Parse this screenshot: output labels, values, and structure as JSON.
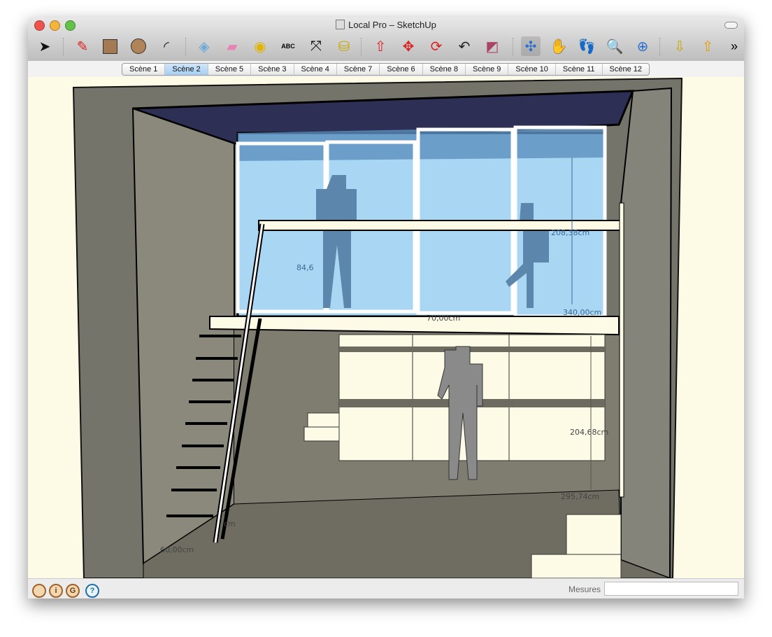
{
  "window": {
    "title": "SketchUp",
    "document_title": "Local Pro"
  },
  "title_separator": " – ",
  "toolbar": {
    "tools": [
      "select-icon",
      "pencil-icon",
      "rectangle-icon",
      "circle-icon",
      "arc-icon",
      "make-component-icon",
      "eraser-icon",
      "tape-measure-icon",
      "text-icon",
      "axes-icon",
      "paint-bucket-icon",
      "push-pull-icon",
      "move-icon",
      "rotate-icon",
      "follow-me-icon",
      "offset-icon",
      "orbit-icon",
      "pan-icon",
      "walk-icon",
      "zoom-icon",
      "zoom-extents-icon",
      "get-models-icon",
      "share-model-icon"
    ],
    "overflow_label": "»"
  },
  "scenes": {
    "tabs": [
      "Scène 1",
      "Scène 2",
      "Scène 5",
      "Scène 3",
      "Scène 4",
      "Scène 7",
      "Scène 6",
      "Scène 8",
      "Scène 9",
      "Scène 10",
      "Scène 11",
      "Scène 12"
    ],
    "active_index": 1
  },
  "viewport": {
    "dimensions": [
      "84,6",
      "208,38cm",
      "340,00cm",
      "70,00cm",
      "204,68cm",
      "295,74cm",
      "60,00cm",
      "cm"
    ]
  },
  "status": {
    "icons": [
      "geo-location-icon",
      "credits-icon",
      "sign-in-icon",
      "help-icon"
    ],
    "help_glyph": "?",
    "measures_label": "Mesures",
    "measures_value": ""
  },
  "colors": {
    "accent": "#a6cff3",
    "glass": "#a9d6f2",
    "ceiling": "#2e2f55",
    "background": "#fdfbe6"
  }
}
